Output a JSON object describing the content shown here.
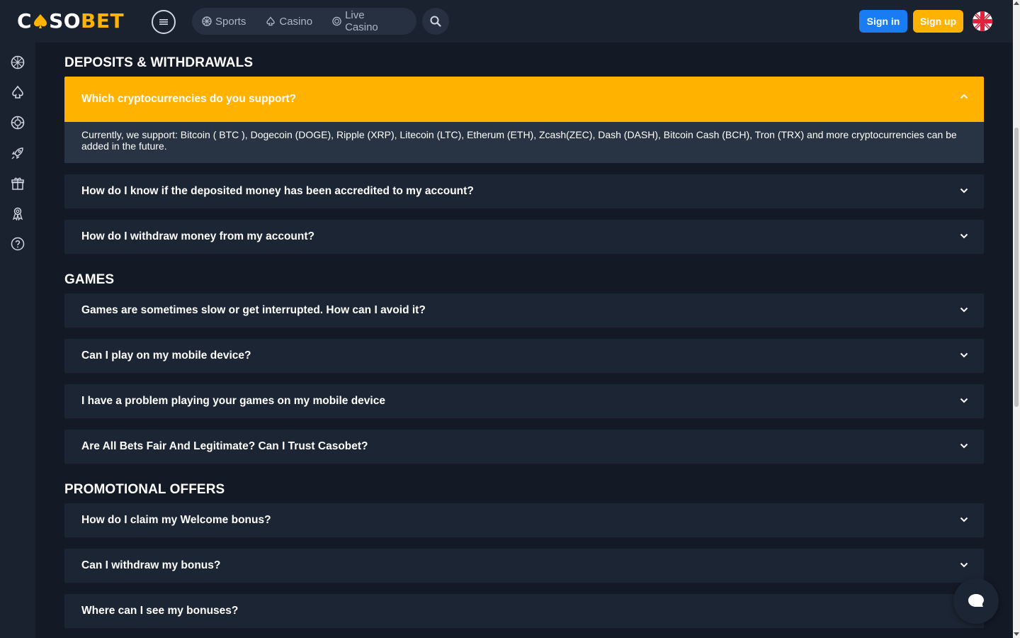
{
  "header": {
    "logo_part1": "C",
    "logo_part2": "SO",
    "logo_part3": "BET",
    "nav": [
      {
        "label": "Sports",
        "icon": "sports-ball-icon"
      },
      {
        "label": "Casino",
        "icon": "spade-icon"
      },
      {
        "label": "Live Casino",
        "icon": "live-casino-icon"
      }
    ],
    "signin_label": "Sign in",
    "signup_label": "Sign up",
    "language_icon": "uk-flag-icon"
  },
  "sidebar": {
    "icons": [
      "sports-ball-icon",
      "spade-icon",
      "live-casino-icon",
      "rocket-icon",
      "gift-icon",
      "vip-icon",
      "help-icon"
    ]
  },
  "sections": [
    {
      "title": "DEPOSITS & WITHDRAWALS",
      "items": [
        {
          "question": "Which cryptocurrencies do you support?",
          "open": true,
          "answer": "Currently, we support: Bitcoin ( BTC ), Dogecoin (DOGE), Ripple (XRP), Litecoin (LTC), Etherum (ETH), Zcash(ZEC), Dash (DASH), Bitcoin Cash (BCH), Tron (TRX) and more cryptocurrencies can be added in the future."
        },
        {
          "question": "How do I know if the deposited money has been accredited to my account?"
        },
        {
          "question": "How do I withdraw money from my account?"
        }
      ]
    },
    {
      "title": "GAMES",
      "items": [
        {
          "question": "Games are sometimes slow or get interrupted. How can I avoid it?"
        },
        {
          "question": "Can I play on my mobile device?"
        },
        {
          "question": "I have a problem playing your games on my mobile device"
        },
        {
          "question": "Are All Bets Fair And Legitimate? Can I Trust Casobet?"
        }
      ]
    },
    {
      "title": "PROMOTIONAL OFFERS",
      "items": [
        {
          "question": "How do I claim my Welcome bonus?"
        },
        {
          "question": "Can I withdraw my bonus?"
        },
        {
          "question": "Where can I see my bonuses?"
        }
      ]
    }
  ],
  "colors": {
    "accent": "#ffb300",
    "primary": "#1a7cf2",
    "background": "#131a26",
    "panel": "#1c2533"
  }
}
